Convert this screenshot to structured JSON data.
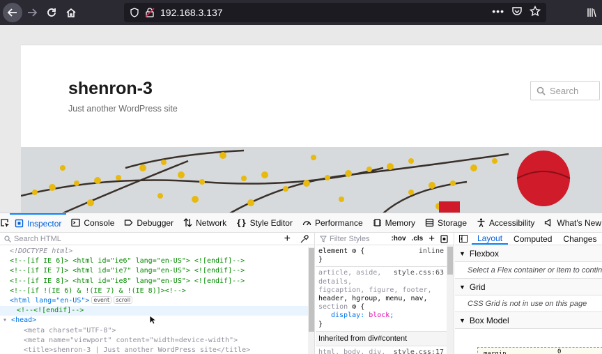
{
  "browser": {
    "url": "192.168.3.137"
  },
  "page": {
    "site_title": "shenron-3",
    "site_description": "Just another WordPress site",
    "search_placeholder": "Search"
  },
  "devtools": {
    "tabs": [
      {
        "label": "Inspector",
        "icon": "inspector-icon"
      },
      {
        "label": "Console",
        "icon": "console-icon"
      },
      {
        "label": "Debugger",
        "icon": "debugger-icon"
      },
      {
        "label": "Network",
        "icon": "network-icon"
      },
      {
        "label": "Style Editor",
        "icon": "style-editor-icon"
      },
      {
        "label": "Performance",
        "icon": "performance-icon"
      },
      {
        "label": "Memory",
        "icon": "memory-icon"
      },
      {
        "label": "Storage",
        "icon": "storage-icon"
      },
      {
        "label": "Accessibility",
        "icon": "accessibility-icon"
      },
      {
        "label": "What's New",
        "icon": "whats-new-icon"
      }
    ],
    "markup": {
      "search_placeholder": "Search HTML",
      "lines": {
        "doctype": "<!DOCTYPE html>",
        "ie6": "<!--[if IE 6]> <html id=\"ie6\" lang=\"en-US\"> <![endif]-->",
        "ie7": "<!--[if IE 7]> <html id=\"ie7\" lang=\"en-US\"> <![endif]-->",
        "ie8": "<!--[if IE 8]> <html id=\"ie8\" lang=\"en-US\"> <![endif]-->",
        "notie": "<!--[if !(IE 6) & !(IE 7) & !(IE 8)]><!-->",
        "html_open": "<html lang=\"en-US\">",
        "badge_event": "event",
        "badge_scroll": "scroll",
        "endif": "<!--<![endif]-->",
        "head": "<head>",
        "meta_charset": "<meta charset=\"UTF-8\">",
        "meta_viewport": "<meta name=\"viewport\" content=\"width=device-width\">",
        "title": "<title>shenron-3 | Just another WordPress site</title>"
      }
    },
    "rules": {
      "filter_placeholder": "Filter Styles",
      "hov": ":hov",
      "cls": ".cls",
      "element_selector": "element",
      "element_source": "inline",
      "rule2_selector_lines": [
        "article, aside,",
        "details,",
        "figcaption, figure, footer,",
        "header, hgroup, menu, nav,",
        "section"
      ],
      "rule2_source": "style.css:63",
      "rule2_prop": "display",
      "rule2_value": "block",
      "inherited_label": "Inherited from div#content",
      "rule3_selector": "html, body, div,",
      "rule3_source": "style.css:17"
    },
    "layout": {
      "tabs": [
        "Layout",
        "Computed",
        "Changes"
      ],
      "flexbox_label": "Flexbox",
      "flexbox_msg": "Select a Flex container or item to continue.",
      "grid_label": "Grid",
      "grid_msg": "CSS Grid is not in use on this page",
      "boxmodel_label": "Box Model",
      "margin_label": "margin",
      "margin_value": "0"
    }
  }
}
